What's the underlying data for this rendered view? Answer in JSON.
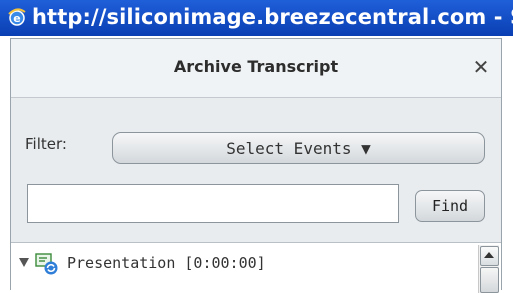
{
  "browser": {
    "title_url": "http://siliconimage.breezecentral.com - S"
  },
  "panel": {
    "title": "Archive Transcript",
    "close_glyph": "✕",
    "filter_label": "Filter:",
    "select_label": "Select Events ▼",
    "search_value": "",
    "find_label": "Find"
  },
  "tree": {
    "items": [
      {
        "label": "Presentation [0:00:00]",
        "icon": "presentation-refresh-icon",
        "expanded": true
      }
    ]
  }
}
